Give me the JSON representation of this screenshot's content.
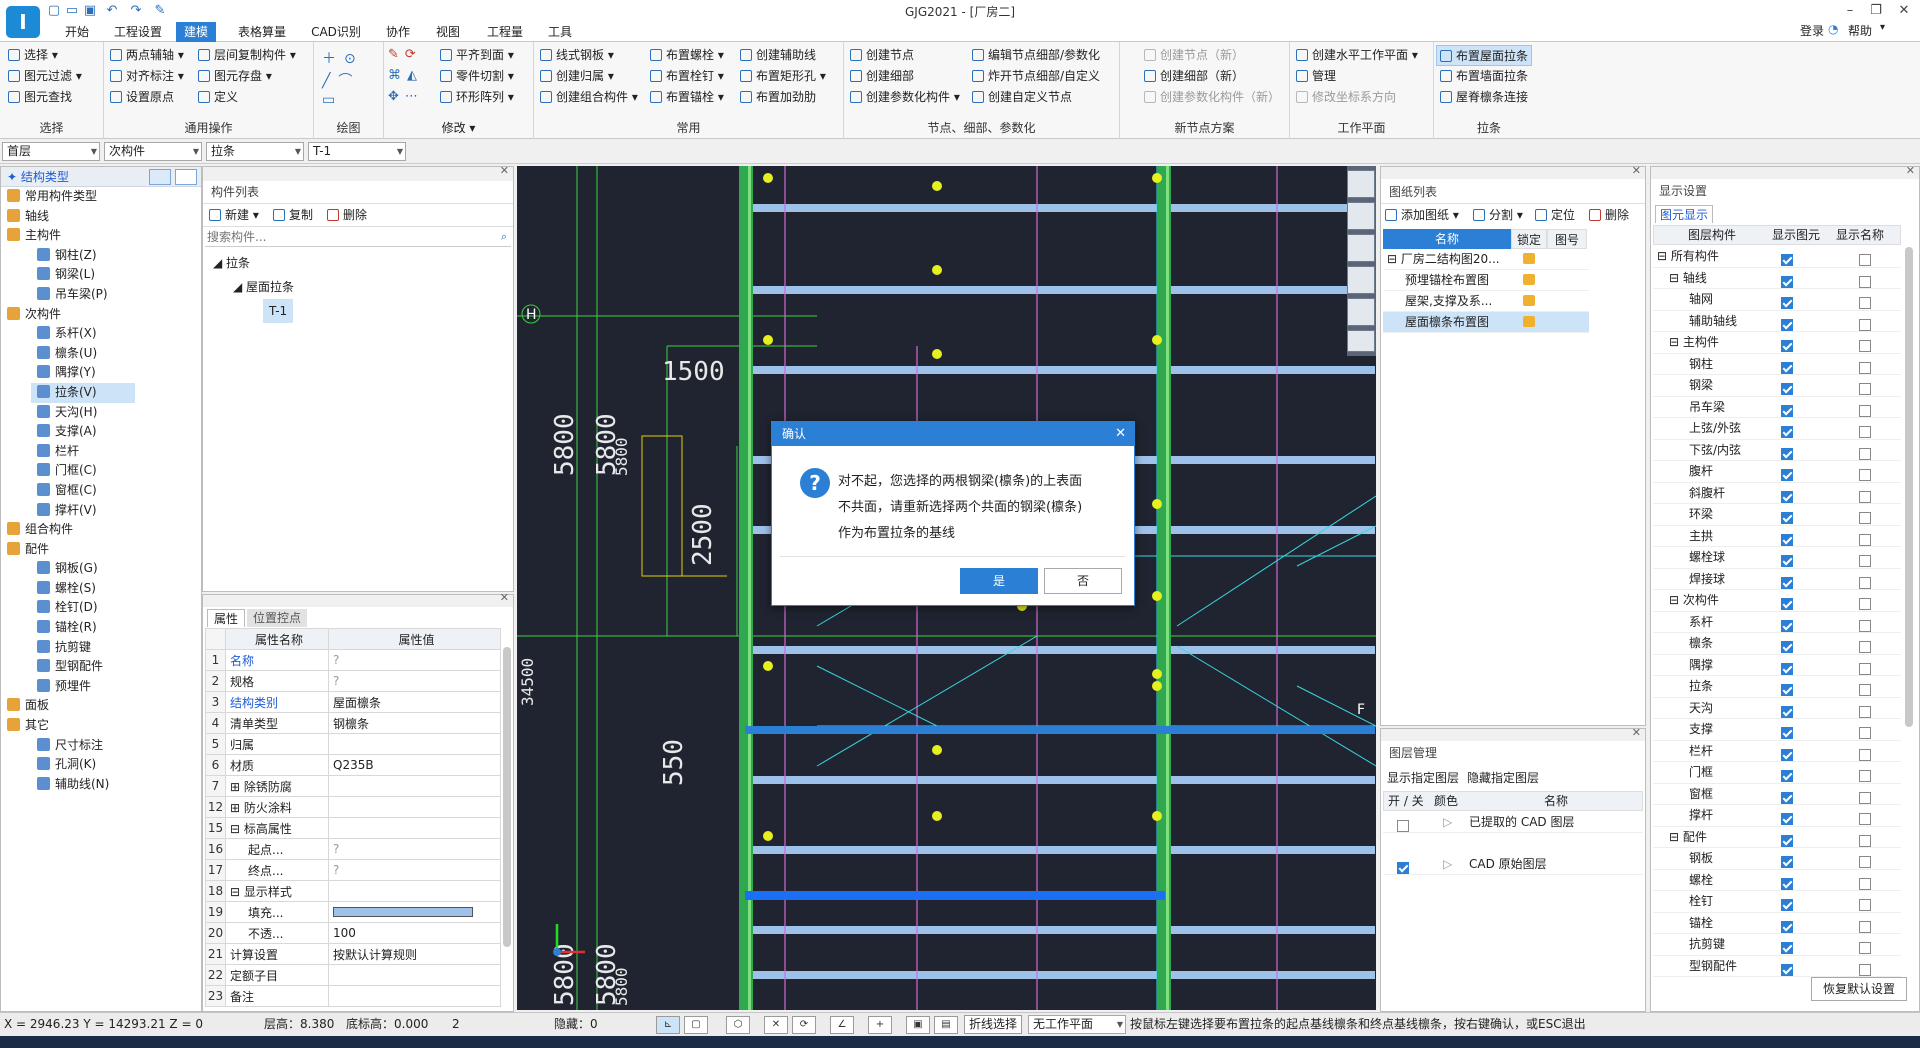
{
  "app": {
    "title": "GJG2021 - [厂房二]",
    "logo_letter": "I",
    "menu_tabs": [
      "开始",
      "工程设置",
      "建模",
      "表格算量",
      "CAD识别",
      "协作",
      "视图",
      "工程量",
      "工具"
    ],
    "active_tab": "建模",
    "login": "登录",
    "help": "帮助",
    "accent_color": "#2b7fd4"
  },
  "ribbon": {
    "groups": [
      {
        "label": "选择",
        "items": [
          "选择",
          "图元过滤",
          "图元查找"
        ]
      },
      {
        "label": "通用操作",
        "items": [
          "两点辅轴",
          "对齐标注",
          "设置原点",
          "层间复制构件",
          "图元存盘",
          "定义"
        ]
      },
      {
        "label": "绘图",
        "items": []
      },
      {
        "label": "修改",
        "items": [
          "平齐到面",
          "零件切割",
          "环形阵列"
        ]
      },
      {
        "label": "常用",
        "items": [
          "线式钢板",
          "创建归属",
          "创建组合构件",
          "布置螺栓",
          "布置栓钉",
          "布置锚栓",
          "创建辅助线",
          "布置矩形孔",
          "布置加劲肋"
        ]
      },
      {
        "label": "节点、细部、参数化",
        "items": [
          "创建节点",
          "创建细部",
          "创建参数化构件",
          "编辑节点细部/参数化",
          "炸开节点细部/自定义",
          "创建自定义节点"
        ]
      },
      {
        "label": "新节点方案",
        "items": [
          "创建节点（新）",
          "创建细部（新）",
          "创建参数化构件（新）"
        ]
      },
      {
        "label": "工作平面",
        "items": [
          "创建水平工作平面",
          "管理",
          "修改坐标系方向"
        ]
      },
      {
        "label": "拉条",
        "items": [
          "布置屋面拉条",
          "布置墙面拉条",
          "屋脊檩条连接"
        ]
      }
    ]
  },
  "filters": {
    "floor": "首层",
    "category": "次构件",
    "type": "拉条",
    "name": "T-1"
  },
  "struct_tree": {
    "title": "结构类型",
    "items": [
      {
        "label": "常用构件类型",
        "level": 0
      },
      {
        "label": "轴线",
        "level": 0
      },
      {
        "label": "主构件",
        "level": 0
      },
      {
        "label": "钢柱(Z)",
        "level": 1
      },
      {
        "label": "钢梁(L)",
        "level": 1
      },
      {
        "label": "吊车梁(P)",
        "level": 1
      },
      {
        "label": "次构件",
        "level": 0
      },
      {
        "label": "系杆(X)",
        "level": 1
      },
      {
        "label": "檩条(U)",
        "level": 1
      },
      {
        "label": "隅撑(Y)",
        "level": 1
      },
      {
        "label": "拉条(V)",
        "level": 1,
        "selected": true
      },
      {
        "label": "天沟(H)",
        "level": 1
      },
      {
        "label": "支撑(A)",
        "level": 1
      },
      {
        "label": "栏杆",
        "level": 1
      },
      {
        "label": "门框(C)",
        "level": 1
      },
      {
        "label": "窗框(C)",
        "level": 1
      },
      {
        "label": "撑杆(V)",
        "level": 1
      },
      {
        "label": "组合构件",
        "level": 0
      },
      {
        "label": "配件",
        "level": 0
      },
      {
        "label": "钢板(G)",
        "level": 1
      },
      {
        "label": "螺栓(S)",
        "level": 1
      },
      {
        "label": "栓钉(D)",
        "level": 1
      },
      {
        "label": "锚栓(R)",
        "level": 1
      },
      {
        "label": "抗剪键",
        "level": 1
      },
      {
        "label": "型钢配件",
        "level": 1
      },
      {
        "label": "预埋件",
        "level": 1
      },
      {
        "label": "面板",
        "level": 0
      },
      {
        "label": "其它",
        "level": 0
      },
      {
        "label": "尺寸标注",
        "level": 1
      },
      {
        "label": "孔洞(K)",
        "level": 1
      },
      {
        "label": "辅助线(N)",
        "level": 1
      }
    ]
  },
  "component_list": {
    "title": "构件列表",
    "new": "新建",
    "copy": "复制",
    "delete": "删除",
    "search_placeholder": "搜索构件...",
    "tree": [
      "拉条",
      "屋面拉条",
      "T-1"
    ]
  },
  "properties": {
    "tabs": [
      "属性",
      "位置控点"
    ],
    "col_name": "属性名称",
    "col_value": "属性值",
    "rows": [
      {
        "n": "1",
        "name": "名称",
        "value": "?",
        "blue": true
      },
      {
        "n": "2",
        "name": "规格",
        "value": "?"
      },
      {
        "n": "3",
        "name": "结构类别",
        "value": "屋面檩条",
        "blue": true
      },
      {
        "n": "4",
        "name": "清单类型",
        "value": "钢檩条"
      },
      {
        "n": "5",
        "name": "归属",
        "value": ""
      },
      {
        "n": "6",
        "name": "材质",
        "value": "Q235B"
      },
      {
        "n": "7",
        "name": "除锈防腐",
        "value": "",
        "group": true
      },
      {
        "n": "12",
        "name": "防火涂料",
        "value": "",
        "group": true
      },
      {
        "n": "15",
        "name": "标高属性",
        "value": "",
        "group": true,
        "open": true
      },
      {
        "n": "16",
        "name": "起点...",
        "value": "?",
        "sub": true
      },
      {
        "n": "17",
        "name": "终点...",
        "value": "?",
        "sub": true
      },
      {
        "n": "18",
        "name": "显示样式",
        "value": "",
        "group": true,
        "open": true
      },
      {
        "n": "19",
        "name": "填充...",
        "value": "",
        "sub": true,
        "fill": true
      },
      {
        "n": "20",
        "name": "不透...",
        "value": "100",
        "sub": true
      },
      {
        "n": "21",
        "name": "计算设置",
        "value": "按默认计算规则"
      },
      {
        "n": "22",
        "name": "定额子目",
        "value": ""
      },
      {
        "n": "23",
        "name": "备注",
        "value": ""
      }
    ]
  },
  "canvas": {
    "dims": [
      "1500",
      "5800",
      "5800",
      "5800",
      "2500",
      "550",
      "5800",
      "5800",
      "34500",
      "5800"
    ],
    "axis_labels": [
      "H",
      "F"
    ]
  },
  "dialog": {
    "title": "确认",
    "lines": [
      "对不起，您选择的两根钢梁(檩条)的上表面",
      "不共面，请重新选择两个共面的钢梁(檩条)",
      "作为布置拉条的基线"
    ],
    "yes": "是",
    "no": "否"
  },
  "drawing_list": {
    "title": "图纸列表",
    "add": "添加图纸",
    "split": "分割",
    "locate": "定位",
    "delete": "删除",
    "cols": [
      "名称",
      "锁定",
      "图号"
    ],
    "rows": [
      {
        "name": "厂房二结构图20...",
        "root": true
      },
      {
        "name": "预埋锚栓布置图"
      },
      {
        "name": "屋架,支撑及系..."
      },
      {
        "name": "屋面檩条布置图",
        "selected": true
      }
    ]
  },
  "layer_mgmt": {
    "title": "图层管理",
    "show": "显示指定图层",
    "hide": "隐藏指定图层",
    "cols": [
      "开 / 关",
      "颜色",
      "名称"
    ],
    "rows": [
      {
        "name": "已提取的 CAD 图层",
        "on": false
      },
      {
        "name": "CAD 原始图层",
        "on": true
      }
    ]
  },
  "display_settings": {
    "title": "显示设置",
    "tab": "图元显示",
    "cols": [
      "图层构件",
      "显示图元",
      "显示名称"
    ],
    "rows": [
      {
        "label": "所有构件",
        "level": 0,
        "show": true,
        "name": false
      },
      {
        "label": "轴线",
        "level": 1,
        "show": true,
        "name": false
      },
      {
        "label": "轴网",
        "level": 2,
        "show": true,
        "name": false
      },
      {
        "label": "辅助轴线",
        "level": 2,
        "show": true,
        "name": false
      },
      {
        "label": "主构件",
        "level": 1,
        "show": true,
        "name": false
      },
      {
        "label": "钢柱",
        "level": 2,
        "show": true,
        "name": false
      },
      {
        "label": "钢梁",
        "level": 2,
        "show": true,
        "name": false
      },
      {
        "label": "吊车梁",
        "level": 2,
        "show": true,
        "name": false
      },
      {
        "label": "上弦/外弦",
        "level": 2,
        "show": true,
        "name": false
      },
      {
        "label": "下弦/内弦",
        "level": 2,
        "show": true,
        "name": false
      },
      {
        "label": "腹杆",
        "level": 2,
        "show": true,
        "name": false
      },
      {
        "label": "斜腹杆",
        "level": 2,
        "show": true,
        "name": false
      },
      {
        "label": "环梁",
        "level": 2,
        "show": true,
        "name": false
      },
      {
        "label": "主拱",
        "level": 2,
        "show": true,
        "name": false
      },
      {
        "label": "螺栓球",
        "level": 2,
        "show": true,
        "name": false
      },
      {
        "label": "焊接球",
        "level": 2,
        "show": true,
        "name": false
      },
      {
        "label": "次构件",
        "level": 1,
        "show": true,
        "name": false
      },
      {
        "label": "系杆",
        "level": 2,
        "show": true,
        "name": false
      },
      {
        "label": "檩条",
        "level": 2,
        "show": true,
        "name": false
      },
      {
        "label": "隅撑",
        "level": 2,
        "show": true,
        "name": false
      },
      {
        "label": "拉条",
        "level": 2,
        "show": true,
        "name": false
      },
      {
        "label": "天沟",
        "level": 2,
        "show": true,
        "name": false
      },
      {
        "label": "支撑",
        "level": 2,
        "show": true,
        "name": false
      },
      {
        "label": "栏杆",
        "level": 2,
        "show": true,
        "name": false
      },
      {
        "label": "门框",
        "level": 2,
        "show": true,
        "name": false
      },
      {
        "label": "窗框",
        "level": 2,
        "show": true,
        "name": false
      },
      {
        "label": "撑杆",
        "level": 2,
        "show": true,
        "name": false
      },
      {
        "label": "配件",
        "level": 1,
        "show": true,
        "name": false
      },
      {
        "label": "钢板",
        "level": 2,
        "show": true,
        "name": false
      },
      {
        "label": "螺栓",
        "level": 2,
        "show": true,
        "name": false
      },
      {
        "label": "栓钉",
        "level": 2,
        "show": true,
        "name": false
      },
      {
        "label": "锚栓",
        "level": 2,
        "show": true,
        "name": false
      },
      {
        "label": "抗剪键",
        "level": 2,
        "show": true,
        "name": false
      },
      {
        "label": "型钢配件",
        "level": 2,
        "show": true,
        "name": false
      }
    ],
    "restore": "恢复默认设置"
  },
  "status": {
    "coords": "X = 2946.23 Y = 14293.21 Z = 0",
    "floor_height": "层高：8.380",
    "base_elev": "底标高：0.000",
    "count": "2",
    "hidden": "隐藏：0",
    "polyline": "折线选择",
    "plane": "无工作平面",
    "hint": "按鼠标左键选择要布置拉条的起点基线檩条和终点基线檩条，按右键确认，或ESC退出"
  }
}
